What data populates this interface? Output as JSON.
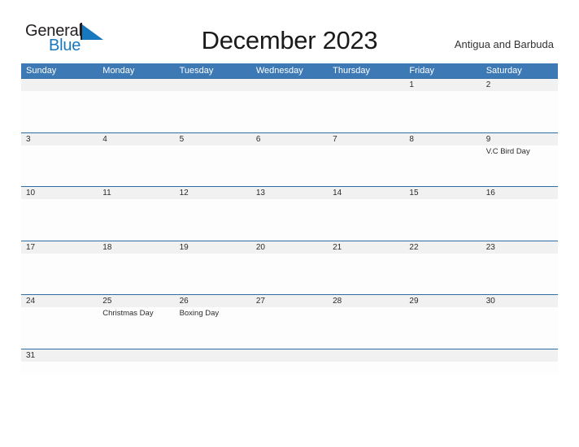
{
  "logo": {
    "word1": "General",
    "word2": "Blue",
    "flag_icon": "flag-triangle-icon",
    "color_dark": "#231f20",
    "color_blue": "#1878be"
  },
  "header": {
    "title": "December 2023",
    "country": "Antigua and Barbuda"
  },
  "theme": {
    "header_blue": "#3c79b5",
    "rule_blue": "#2e6da4",
    "date_band_gray": "#f1f1f1",
    "cell_white": "#fdfdfd"
  },
  "calendar": {
    "weekdays": [
      "Sunday",
      "Monday",
      "Tuesday",
      "Wednesday",
      "Thursday",
      "Friday",
      "Saturday"
    ],
    "weeks": [
      [
        {
          "day": "",
          "event": ""
        },
        {
          "day": "",
          "event": ""
        },
        {
          "day": "",
          "event": ""
        },
        {
          "day": "",
          "event": ""
        },
        {
          "day": "",
          "event": ""
        },
        {
          "day": "1",
          "event": ""
        },
        {
          "day": "2",
          "event": ""
        }
      ],
      [
        {
          "day": "3",
          "event": ""
        },
        {
          "day": "4",
          "event": ""
        },
        {
          "day": "5",
          "event": ""
        },
        {
          "day": "6",
          "event": ""
        },
        {
          "day": "7",
          "event": ""
        },
        {
          "day": "8",
          "event": ""
        },
        {
          "day": "9",
          "event": "V.C Bird Day"
        }
      ],
      [
        {
          "day": "10",
          "event": ""
        },
        {
          "day": "11",
          "event": ""
        },
        {
          "day": "12",
          "event": ""
        },
        {
          "day": "13",
          "event": ""
        },
        {
          "day": "14",
          "event": ""
        },
        {
          "day": "15",
          "event": ""
        },
        {
          "day": "16",
          "event": ""
        }
      ],
      [
        {
          "day": "17",
          "event": ""
        },
        {
          "day": "18",
          "event": ""
        },
        {
          "day": "19",
          "event": ""
        },
        {
          "day": "20",
          "event": ""
        },
        {
          "day": "21",
          "event": ""
        },
        {
          "day": "22",
          "event": ""
        },
        {
          "day": "23",
          "event": ""
        }
      ],
      [
        {
          "day": "24",
          "event": ""
        },
        {
          "day": "25",
          "event": "Christmas Day"
        },
        {
          "day": "26",
          "event": "Boxing Day"
        },
        {
          "day": "27",
          "event": ""
        },
        {
          "day": "28",
          "event": ""
        },
        {
          "day": "29",
          "event": ""
        },
        {
          "day": "30",
          "event": ""
        }
      ],
      [
        {
          "day": "31",
          "event": ""
        },
        {
          "day": "",
          "event": ""
        },
        {
          "day": "",
          "event": ""
        },
        {
          "day": "",
          "event": ""
        },
        {
          "day": "",
          "event": ""
        },
        {
          "day": "",
          "event": ""
        },
        {
          "day": "",
          "event": ""
        }
      ]
    ]
  }
}
